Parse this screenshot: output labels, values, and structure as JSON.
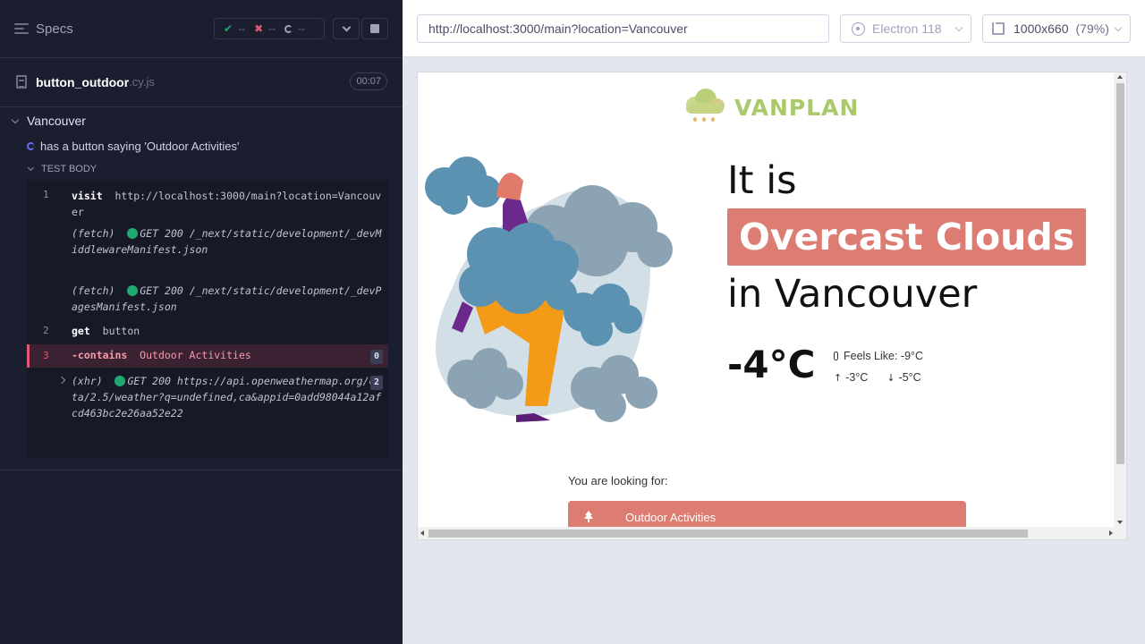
{
  "reporter": {
    "specs_label": "Specs",
    "stats": {
      "passed": "--",
      "failed": "--",
      "pending": "--"
    },
    "file": {
      "name": "button_outdoor",
      "ext": ".cy.js",
      "duration": "00:07"
    },
    "suite_title": "Vancouver",
    "test_title": "has a button saying 'Outdoor Activities'",
    "test_body_label": "TEST BODY",
    "commands": [
      {
        "num": "1",
        "name": "visit",
        "arg": "http://localhost:3000/main?location=Vancouver"
      },
      {
        "num": "",
        "name": "(fetch)",
        "method": "GET 200",
        "arg": "/_next/static/development/_devMiddlewareManifest.json"
      },
      {
        "num": "",
        "name": "(fetch)",
        "method": "GET 200",
        "arg": "/_next/static/development/_devPagesManifest.json"
      },
      {
        "num": "2",
        "name": "get",
        "arg": "button"
      },
      {
        "num": "3",
        "name": "-contains",
        "arg": "Outdoor Activities",
        "badge": "0"
      },
      {
        "num": "",
        "name": "(xhr)",
        "method": "GET 200",
        "arg": "https://api.openweathermap.org/data/2.5/weather?q=undefined,ca&appid=0add98044a12afcd463bc2e26aa52e22",
        "badge": "2"
      }
    ]
  },
  "aut": {
    "url": "http://localhost:3000/main?location=Vancouver",
    "browser": "Electron 118",
    "viewport": "1000x660",
    "zoom": "(79%)"
  },
  "app": {
    "logo_text": "VANPLAN",
    "line1": "It is",
    "condition": "Overcast Clouds",
    "line3": "in Vancouver",
    "temperature": "-4°C",
    "feels_like": "Feels Like: -9°C",
    "temp_max": "-3°C",
    "temp_min": "-5°C",
    "looking_for": "You are looking for:",
    "activity_button": "Outdoor Activities"
  },
  "colors": {
    "reporter_bg": "#1b1e2e",
    "accent_red": "#dc7c72",
    "pass_green": "#1fa971",
    "fail_pink": "#e45770",
    "logo_green": "#a9c96a"
  },
  "icons": [
    "menu-icon",
    "check-icon",
    "x-icon",
    "pending-icon",
    "chevron-down-icon",
    "stop-icon",
    "document-icon",
    "spinner-icon",
    "electron-icon",
    "ruler-icon",
    "thermometer-icon",
    "arrow-up-icon",
    "arrow-down-icon",
    "tree-icon",
    "cloud-logo-icon"
  ]
}
